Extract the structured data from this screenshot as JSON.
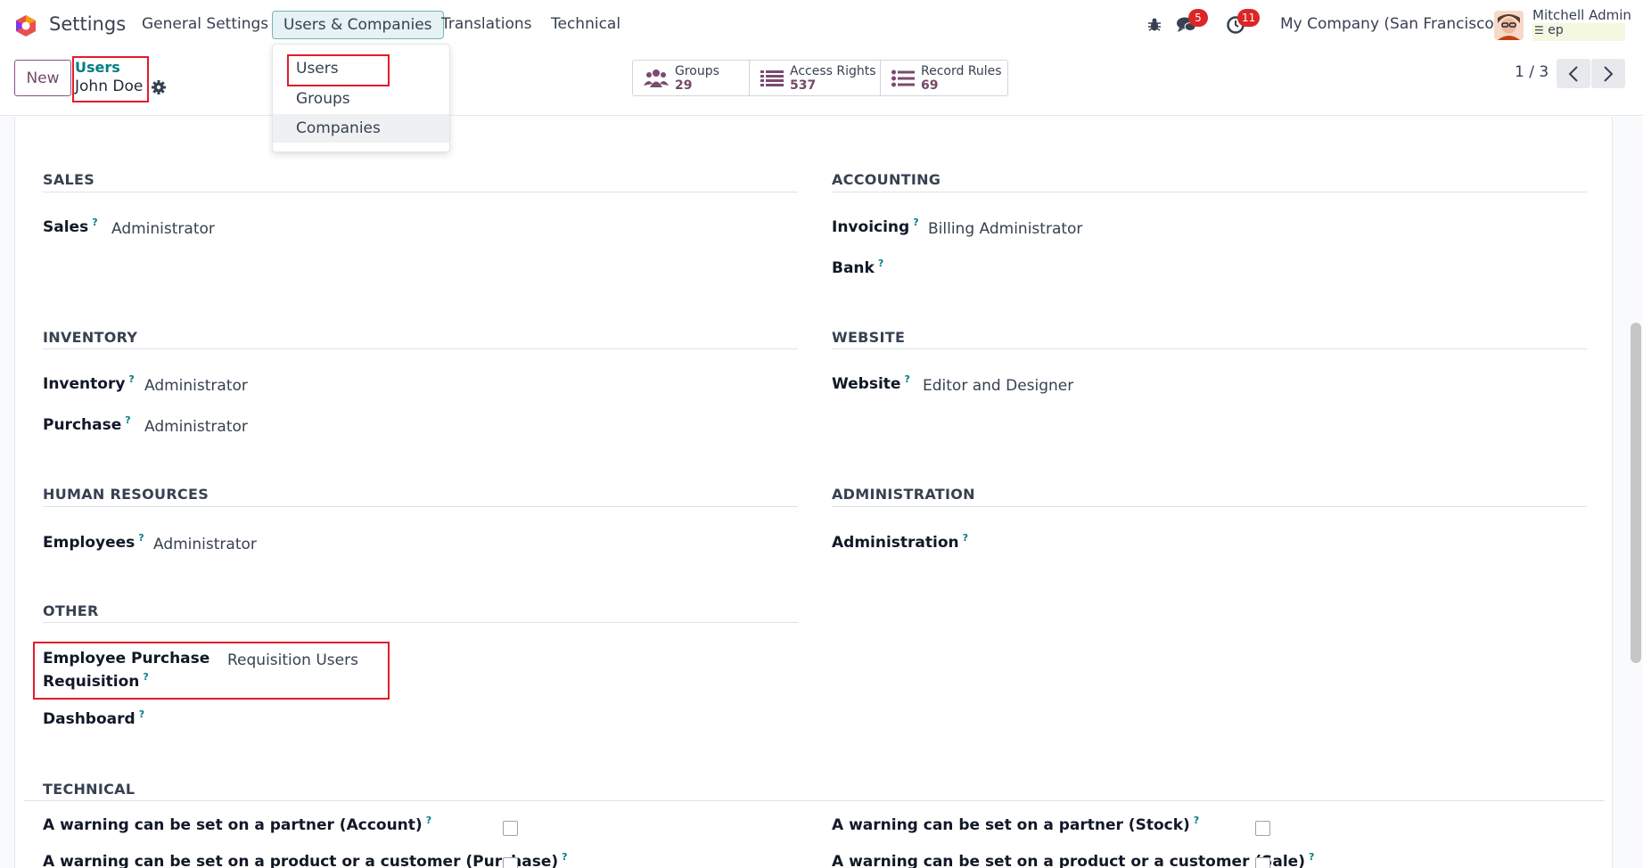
{
  "navbar": {
    "app_name": "Settings",
    "menu": [
      "General Settings",
      "Users & Companies",
      "Translations",
      "Technical"
    ],
    "messages_count": "5",
    "activities_count": "11",
    "company": "My Company (San Francisco)",
    "user_name": "Mitchell Admin",
    "db_name": "ep"
  },
  "dropdown": {
    "items": [
      "Users",
      "Groups",
      "Companies"
    ]
  },
  "control_panel": {
    "new_label": "New",
    "breadcrumb_parent": "Users",
    "breadcrumb_current": "John Doe",
    "stats": [
      {
        "label": "Groups",
        "count": "29"
      },
      {
        "label": "Access Rights",
        "count": "537"
      },
      {
        "label": "Record Rules",
        "count": "69"
      }
    ],
    "pager": "1 / 3"
  },
  "sections": {
    "sales": {
      "title": "SALES",
      "fields": [
        {
          "label": "Sales",
          "value": "Administrator"
        }
      ]
    },
    "accounting": {
      "title": "ACCOUNTING",
      "fields": [
        {
          "label": "Invoicing",
          "value": "Billing Administrator"
        },
        {
          "label": "Bank",
          "value": ""
        }
      ]
    },
    "inventory": {
      "title": "INVENTORY",
      "fields": [
        {
          "label": "Inventory",
          "value": "Administrator"
        },
        {
          "label": "Purchase",
          "value": "Administrator"
        }
      ]
    },
    "website": {
      "title": "WEBSITE",
      "fields": [
        {
          "label": "Website",
          "value": "Editor and Designer"
        }
      ]
    },
    "hr": {
      "title": "HUMAN RESOURCES",
      "fields": [
        {
          "label": "Employees",
          "value": "Administrator"
        }
      ]
    },
    "administration": {
      "title": "ADMINISTRATION",
      "fields": [
        {
          "label": "Administration",
          "value": ""
        }
      ]
    },
    "other": {
      "title": "OTHER",
      "fields": [
        {
          "label_line1": "Employee Purchase",
          "label_line2": "Requisition",
          "value": "Requisition Users"
        },
        {
          "label": "Dashboard",
          "value": ""
        }
      ]
    },
    "technical": {
      "title": "TECHNICAL",
      "fields": [
        {
          "label": "A warning can be set on a partner (Account)"
        },
        {
          "label": "A warning can be set on a partner (Stock)"
        },
        {
          "label": "A warning can be set on a product or a customer (Purchase)"
        },
        {
          "label": "A warning can be set on a product or a customer (Sale)"
        }
      ]
    }
  },
  "help_mark": "?"
}
